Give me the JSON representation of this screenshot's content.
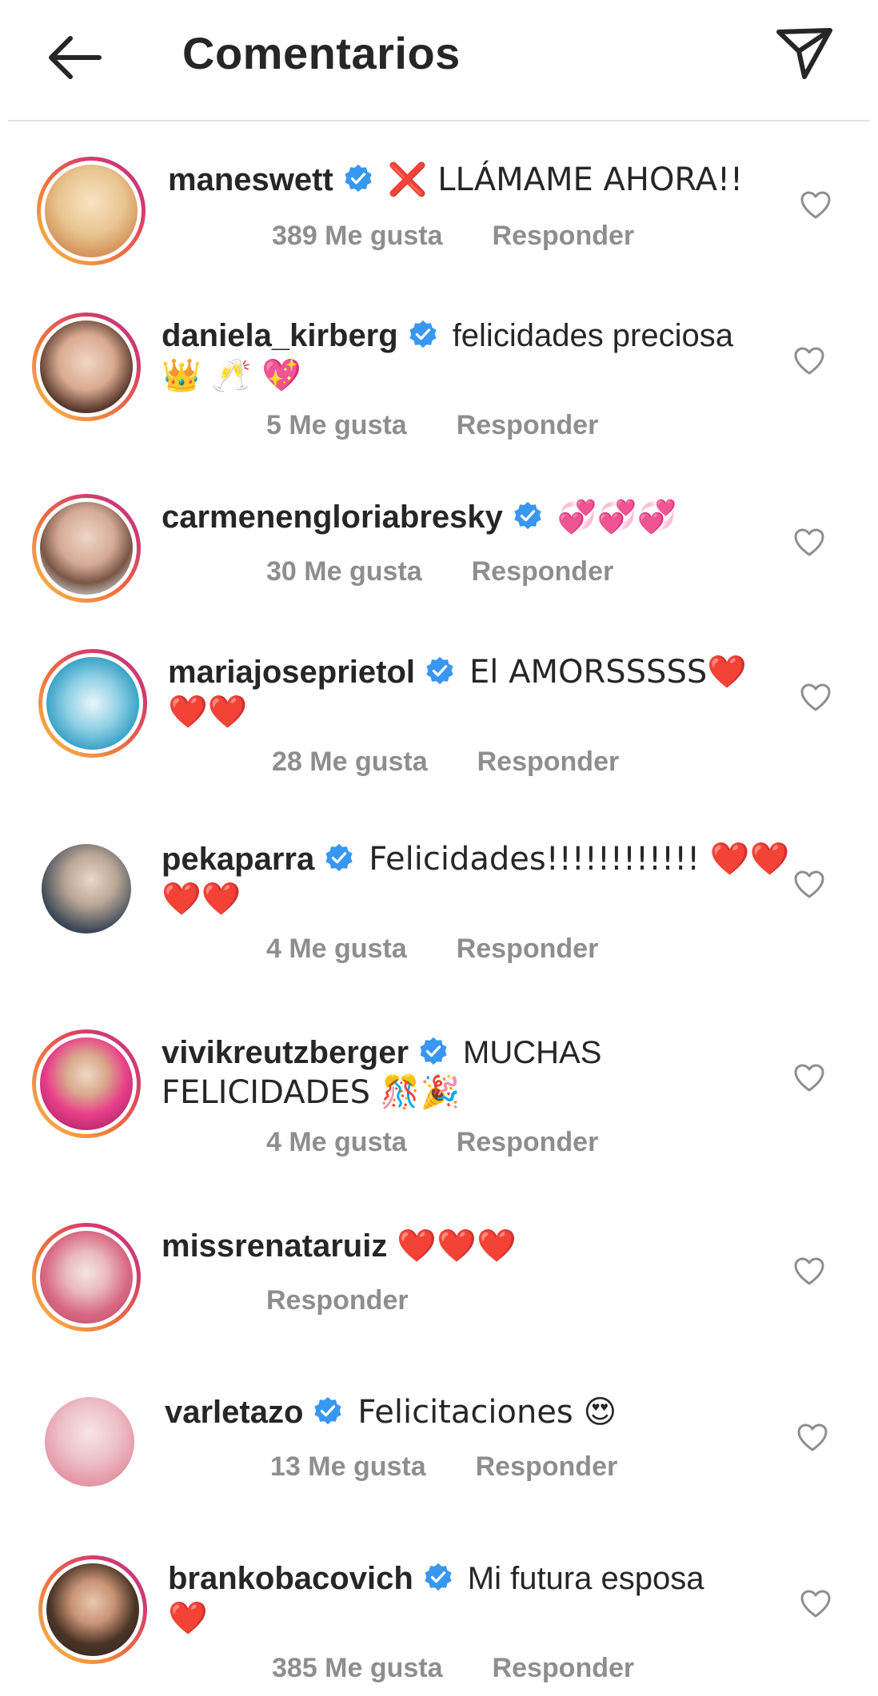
{
  "header": {
    "title": "Comentarios"
  },
  "colors": {
    "verified": "#3897f0",
    "meta": "#8e8e8e",
    "text": "#262626"
  },
  "comments": [
    {
      "username": "maneswett",
      "line1": "❌ LLÁMAME AHORA!!",
      "line2": "",
      "likes": "389 Me gusta",
      "reply": "Responder"
    },
    {
      "username": "daniela_kirberg",
      "line1": "felicidades preciosa",
      "line2": "👑 🥂 💖",
      "likes": "5 Me gusta",
      "reply": "Responder"
    },
    {
      "username": "carmenengloriabresky",
      "line1": "💞💞💞",
      "line2": "",
      "likes": "30 Me gusta",
      "reply": "Responder"
    },
    {
      "username": "mariajoseprietol",
      "line1": "El AMORSSSSS❤️",
      "line2": "❤️❤️",
      "likes": "28 Me gusta",
      "reply": "Responder"
    },
    {
      "username": "pekaparra",
      "line1": "Felicidades!!!!!!!!!!!! ❤️❤️",
      "line2": "❤️❤️",
      "likes": "4 Me gusta",
      "reply": "Responder"
    },
    {
      "username": "vivikreutzberger",
      "line1": "MUCHAS",
      "line2": "FELICIDADES 🎊🎉",
      "likes": "4 Me gusta",
      "reply": "Responder"
    },
    {
      "username": "missrenataruiz",
      "line1": "❤️❤️❤️",
      "line2": "",
      "likes": "",
      "reply": "Responder"
    },
    {
      "username": "varletazo",
      "line1": "Felicitaciones 😍",
      "line2": "",
      "likes": "13 Me gusta",
      "reply": "Responder"
    },
    {
      "username": "brankobacovich",
      "line1": "Mi futura esposa",
      "line2": "❤️",
      "likes": "385 Me gusta",
      "reply": "Responder"
    }
  ]
}
